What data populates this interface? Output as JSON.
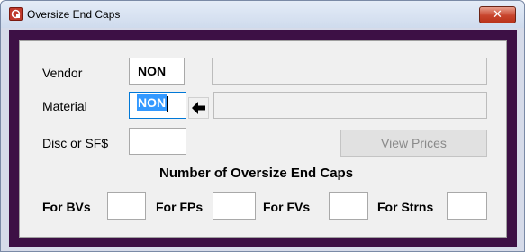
{
  "window": {
    "title": "Oversize End Caps",
    "close_glyph": "✕",
    "app_icon": "app-logo-icon",
    "colors": {
      "frame": "#3d1045",
      "panel": "#f0f0f0",
      "close": "#c8452d",
      "selection": "#3399ff"
    }
  },
  "form": {
    "vendor_label": "Vendor",
    "vendor_value": "NON",
    "vendor_desc": "",
    "material_label": "Material",
    "material_value": "NON",
    "material_desc": "",
    "lookup_icon": "left-arrow-icon",
    "disc_label": "Disc or SF$",
    "disc_value": "",
    "view_prices_label": "View Prices",
    "section_heading": "Number of Oversize End Caps",
    "counts": [
      {
        "label": "For BVs",
        "value": ""
      },
      {
        "label": "For FPs",
        "value": ""
      },
      {
        "label": "For FVs",
        "value": ""
      },
      {
        "label": "For Strns",
        "value": ""
      }
    ]
  }
}
